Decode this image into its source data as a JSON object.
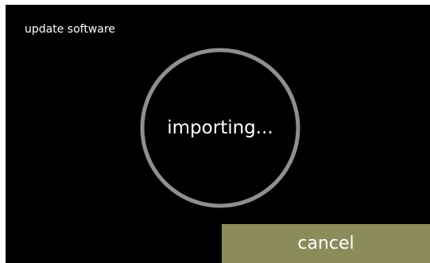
{
  "screen": {
    "title": "update software",
    "status": "importing...",
    "cancel_label": "cancel"
  },
  "colors": {
    "background": "#000000",
    "ring": "#8f8f8f",
    "text": "#ffffff",
    "cancel_button": "#8c8b5c"
  }
}
